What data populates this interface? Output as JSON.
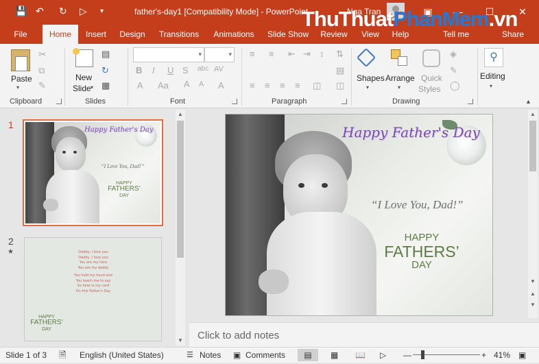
{
  "titlebar": {
    "doc_title": "father's-day1 [Compatibility Mode] - PowerPoint",
    "user_name": "Nga Tran",
    "watermark_a": "ThuThuat",
    "watermark_b": "PhanMem",
    "watermark_c": ".vn"
  },
  "tabs": [
    "File",
    "Home",
    "Insert",
    "Design",
    "Transitions",
    "Animations",
    "Slide Show",
    "Review",
    "View",
    "Help",
    "Tell me",
    "Share"
  ],
  "ribbon": {
    "clipboard": {
      "paste": "Paste",
      "group": "Clipboard"
    },
    "slides": {
      "new_slide_1": "New",
      "new_slide_2": "Slide",
      "group": "Slides"
    },
    "font": {
      "group": "Font"
    },
    "paragraph": {
      "group": "Paragraph"
    },
    "drawing": {
      "shapes": "Shapes",
      "arrange": "Arrange",
      "quick_styles_1": "Quick",
      "quick_styles_2": "Styles",
      "group": "Drawing"
    },
    "editing": {
      "label": "Editing"
    }
  },
  "thumbnails": [
    {
      "number": "1",
      "star": ""
    },
    {
      "number": "2",
      "star": "★"
    }
  ],
  "slide1": {
    "title": "Happy Father's Day",
    "quote": "“I Love You, Dad!”",
    "happy": "HAPPY",
    "fathers": "FATHERS’",
    "day": "DAY"
  },
  "slide2": {
    "poem": [
      "Daddy, I love you",
      "Daddy, I love you",
      "You are my hero",
      "You are my daddy",
      "",
      "You hold my hand and",
      "You teach me to say",
      "So here is my card",
      "On this Father's Day"
    ],
    "happy": "HAPPY",
    "fathers": "FATHERS’",
    "day": "DAY"
  },
  "notes": {
    "placeholder": "Click to add notes"
  },
  "statusbar": {
    "slide_info": "Slide 1 of 3",
    "language": "English (United States)",
    "notes": "Notes",
    "comments": "Comments",
    "zoom": "41%"
  }
}
